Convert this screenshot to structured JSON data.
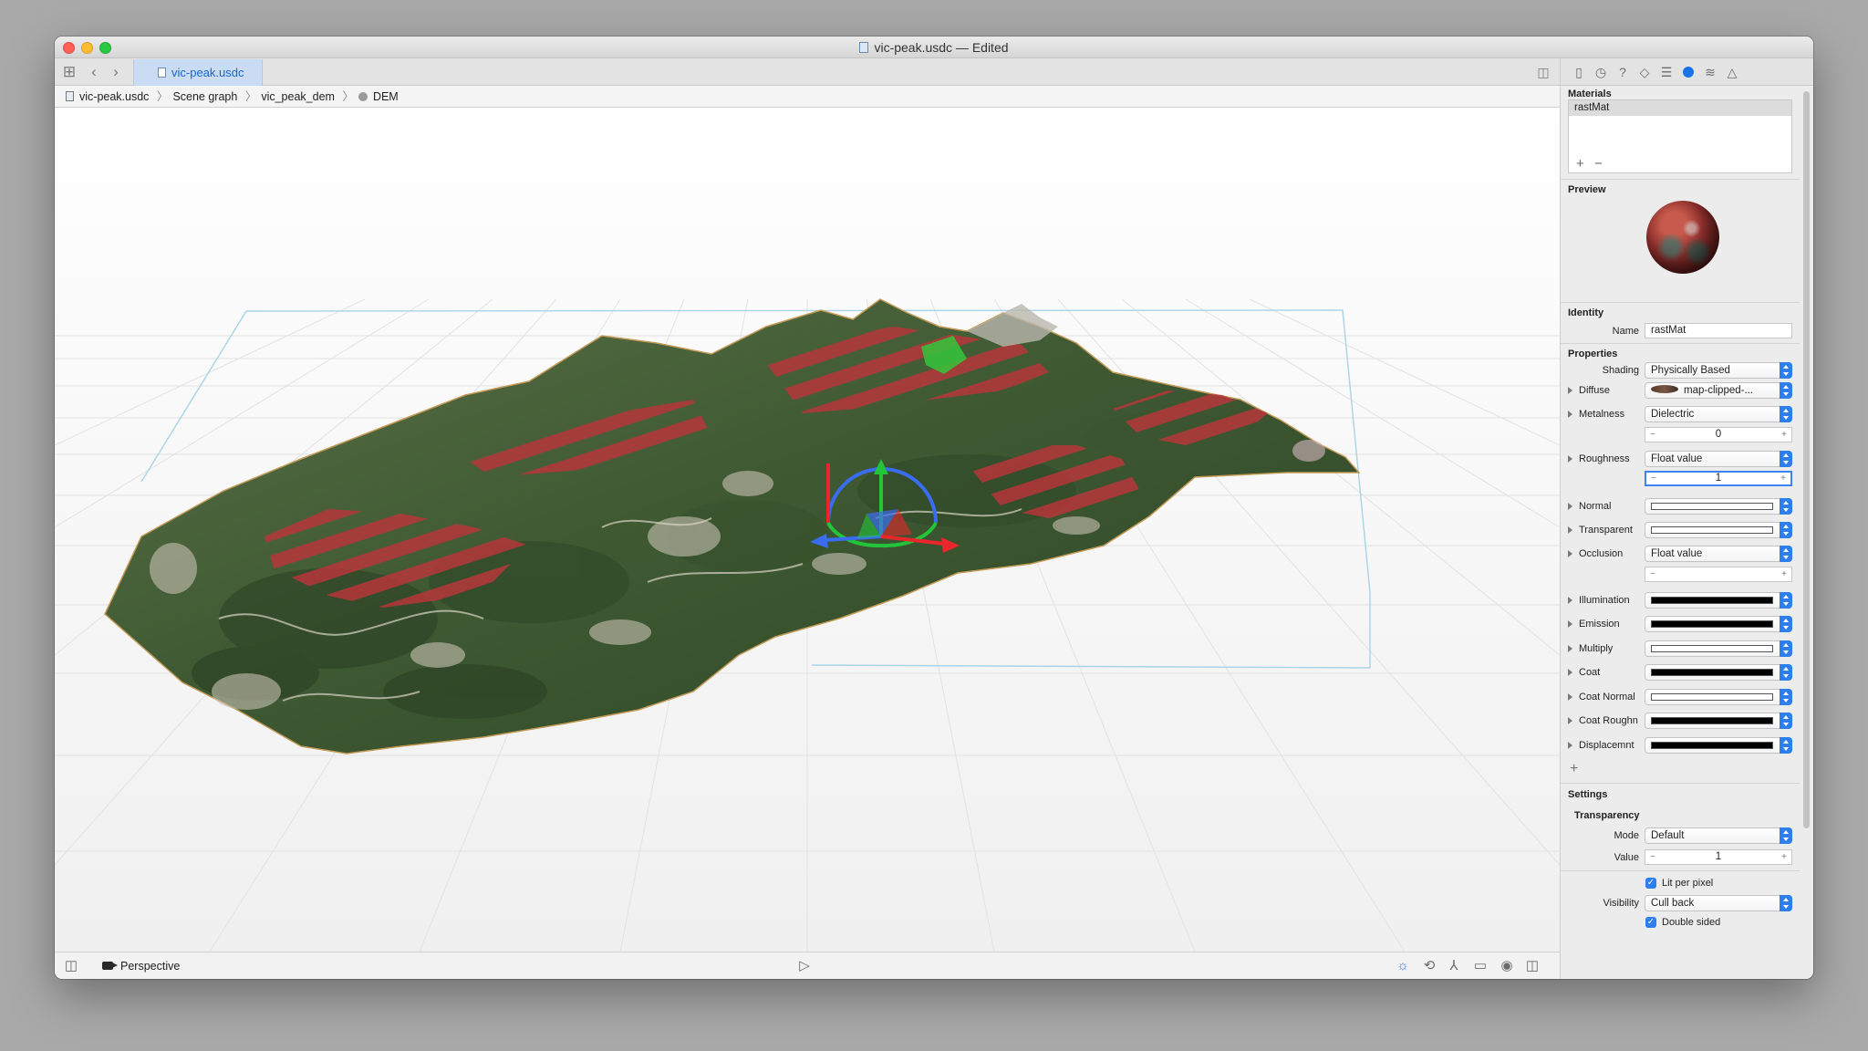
{
  "window": {
    "title": "vic-peak.usdc — Edited"
  },
  "toolbar": {
    "tab_label": "vic-peak.usdc"
  },
  "breadcrumb": [
    "vic-peak.usdc",
    "Scene graph",
    "vic_peak_dem",
    "DEM"
  ],
  "bottom_bar": {
    "camera_label": "Perspective"
  },
  "inspector": {
    "materials_title": "Materials",
    "materials": [
      "rastMat"
    ],
    "add_symbol": "+",
    "remove_symbol": "−",
    "preview_title": "Preview",
    "identity_title": "Identity",
    "name_label": "Name",
    "name_value": "rastMat",
    "properties_title": "Properties",
    "shading_label": "Shading",
    "shading_value": "Physically Based",
    "diffuse_label": "Diffuse",
    "diffuse_value": "map-clipped-...",
    "metalness_label": "Metalness",
    "metalness_value": "Dielectric",
    "metalness_number": "0",
    "roughness_label": "Roughness",
    "roughness_value": "Float value",
    "roughness_number": "1",
    "normal_label": "Normal",
    "transparent_label": "Transparent",
    "occlusion_label": "Occlusion",
    "occlusion_value": "Float value",
    "illumination_label": "Illumination",
    "emission_label": "Emission",
    "multiply_label": "Multiply",
    "coat_label": "Coat",
    "coat_normal_label": "Coat Normal",
    "coat_rough_label": "Coat Roughn",
    "displacement_label": "Displacemnt",
    "add_property": "+",
    "settings_title": "Settings",
    "transparency_title": "Transparency",
    "mode_label": "Mode",
    "mode_value": "Default",
    "value_label": "Value",
    "value_number": "1",
    "lit_per_pixel_label": "Lit per pixel",
    "visibility_label": "Visibility",
    "visibility_value": "Cull back",
    "double_sided_label": "Double sided",
    "stepper_minus": "−",
    "stepper_plus": "+",
    "check_mark": "✓"
  },
  "colors": {
    "accent": "#2d7ff0",
    "gizmo_x": "#e8262b",
    "gizmo_y": "#22c53a",
    "gizmo_z": "#3a6cf0",
    "terrain": "#3f5a33",
    "slope_overlay": "#b5363a"
  }
}
